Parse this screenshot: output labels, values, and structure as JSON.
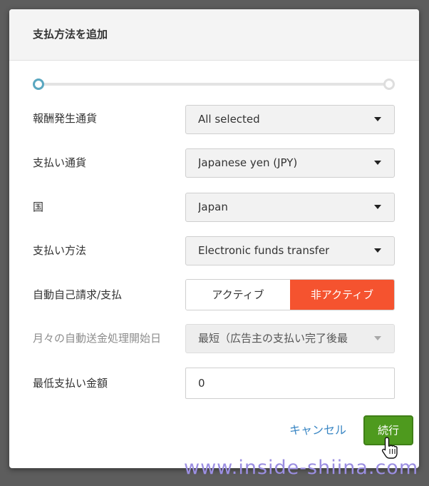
{
  "dialog": {
    "title": "支払方法を追加",
    "fields": {
      "currency_generated": {
        "label": "報酬発生通貨",
        "value": "All selected"
      },
      "payment_currency": {
        "label": "支払い通貨",
        "value": "Japanese yen (JPY)"
      },
      "country": {
        "label": "国",
        "value": "Japan"
      },
      "payment_method": {
        "label": "支払い方法",
        "value": "Electronic funds transfer"
      },
      "auto_invoice": {
        "label": "自動自己請求/支払",
        "active_label": "アクティブ",
        "inactive_label": "非アクティブ",
        "selected": "非アクティブ"
      },
      "auto_transfer_start": {
        "label": "月々の自動送金処理開始日",
        "value": "最短（広告主の支払い完了後最"
      },
      "minimum_amount": {
        "label": "最低支払い金額",
        "value": "0"
      }
    },
    "actions": {
      "cancel_label": "キャンセル",
      "continue_label": "続行"
    }
  },
  "watermark": "www.inside-shiina.com",
  "colors": {
    "accent_blue": "#5aa7c0",
    "inactive_orange": "#f5532f",
    "continue_green": "#4e9a1e",
    "link_blue": "#3b87c4"
  }
}
